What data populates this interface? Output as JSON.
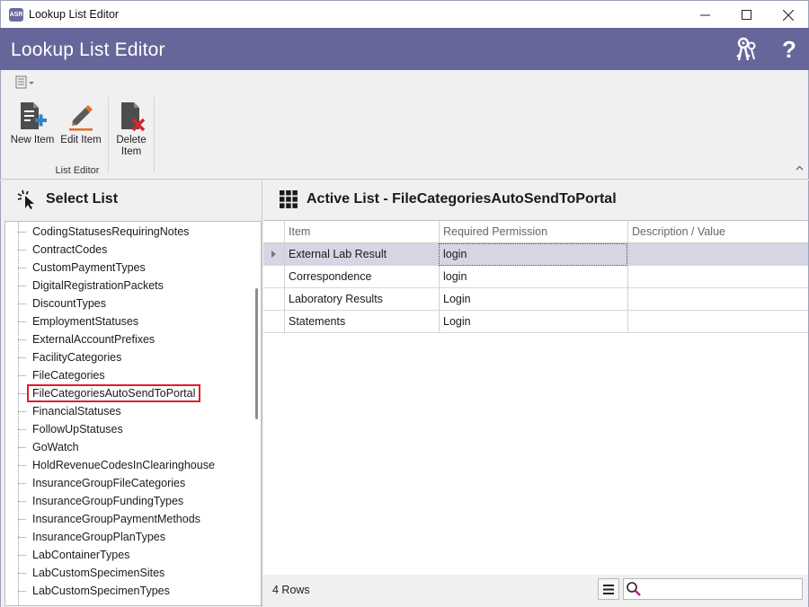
{
  "window": {
    "title": "Lookup List Editor",
    "app_icon_text": "ASR"
  },
  "header": {
    "title": "Lookup List Editor",
    "help_glyph": "?"
  },
  "ribbon": {
    "buttons": [
      {
        "label": "New Item",
        "icon": "new-document-plus-icon"
      },
      {
        "label": "Edit Item",
        "icon": "pencil-icon"
      },
      {
        "label": "Delete Item",
        "icon": "delete-document-icon"
      }
    ],
    "group_label": "List Editor"
  },
  "select_list": {
    "title": "Select List",
    "items": [
      "CodingStatusesRequiringNotes",
      "ContractCodes",
      "CustomPaymentTypes",
      "DigitalRegistrationPackets",
      "DiscountTypes",
      "EmploymentStatuses",
      "ExternalAccountPrefixes",
      "FacilityCategories",
      "FileCategories",
      "FileCategoriesAutoSendToPortal",
      "FinancialStatuses",
      "FollowUpStatuses",
      "GoWatch",
      "HoldRevenueCodesInClearinghouse",
      "InsuranceGroupFileCategories",
      "InsuranceGroupFundingTypes",
      "InsuranceGroupPaymentMethods",
      "InsuranceGroupPlanTypes",
      "LabContainerTypes",
      "LabCustomSpecimenSites",
      "LabCustomSpecimenTypes"
    ],
    "selected": "FileCategoriesAutoSendToPortal"
  },
  "active_list": {
    "title": "Active List - FileCategoriesAutoSendToPortal",
    "columns": [
      "Item",
      "Required Permission",
      "Description / Value"
    ],
    "rows": [
      {
        "item": "External Lab Result",
        "permission": "login",
        "description": ""
      },
      {
        "item": "Correspondence",
        "permission": "login",
        "description": ""
      },
      {
        "item": "Laboratory Results",
        "permission": "Login",
        "description": ""
      },
      {
        "item": "Statements",
        "permission": "Login",
        "description": ""
      }
    ],
    "row_count": "4 Rows",
    "search_placeholder": ""
  },
  "colors": {
    "header_bg": "#67669a",
    "selection_outline": "#e21d2a",
    "active_row_bg": "#d5d5e3",
    "delete_accent": "#d2262e",
    "new_accent": "#2c86c9",
    "edit_accent": "#e06f2c"
  }
}
